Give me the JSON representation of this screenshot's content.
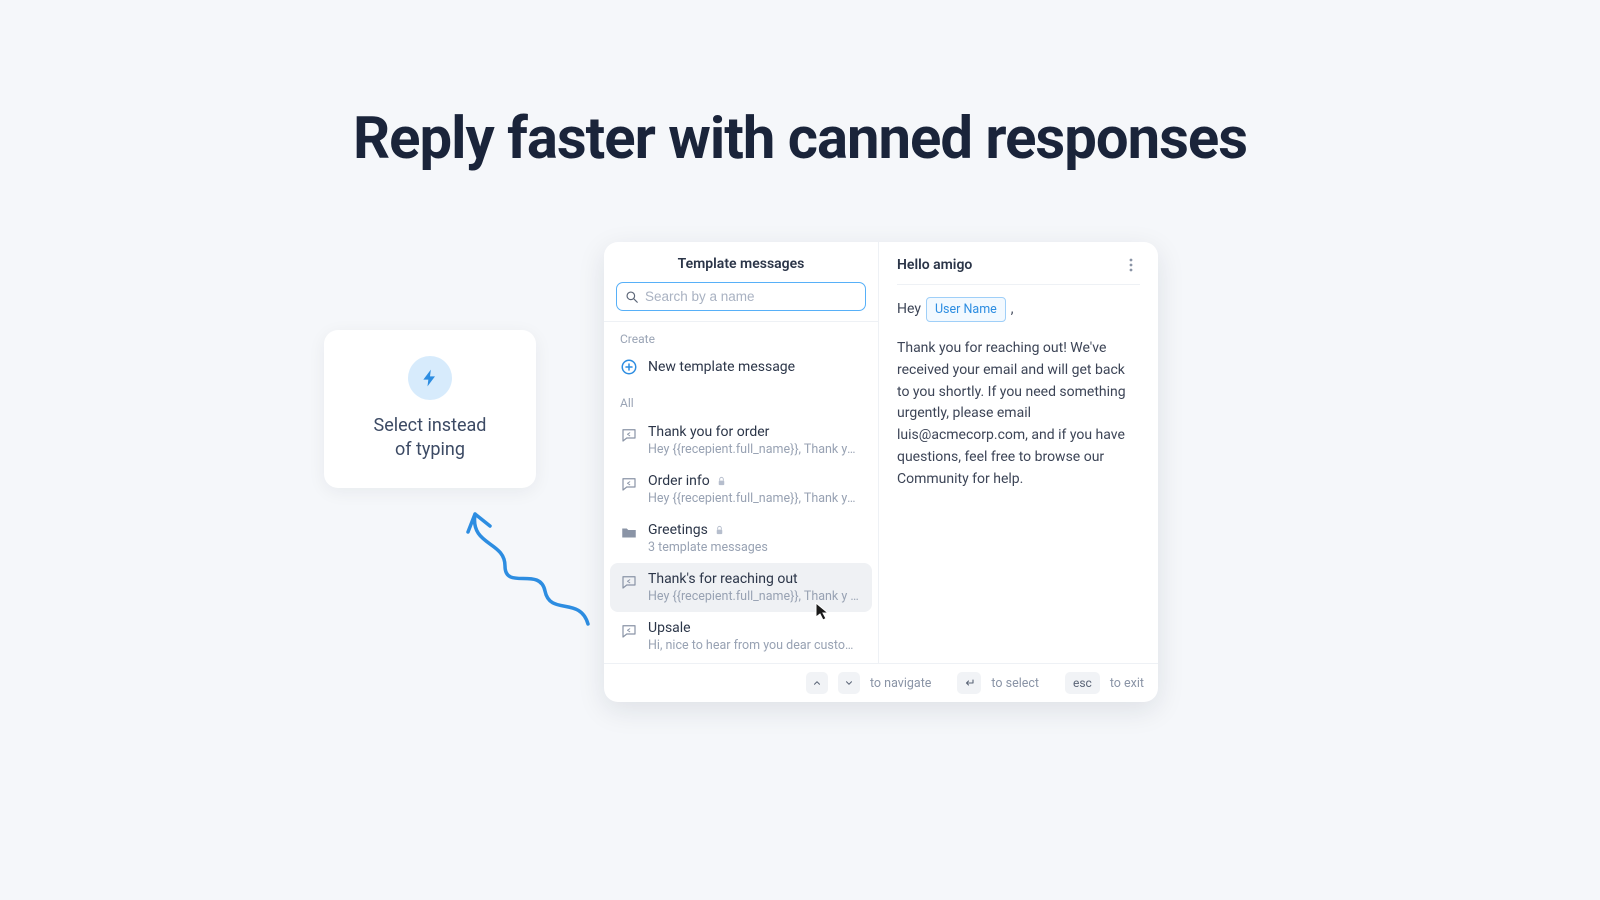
{
  "hero_title": "Reply faster with canned responses",
  "callout": {
    "line1": "Select instead",
    "line2": "of typing"
  },
  "modal": {
    "left_title": "Template messages",
    "search_placeholder": "Search by a name",
    "section_create": "Create",
    "new_template_label": "New template message",
    "section_all": "All",
    "items": [
      {
        "title": "Thank you for order",
        "subtitle": "Hey {{recepient.full_name}}, Thank you for yo...",
        "type": "msg",
        "locked": false
      },
      {
        "title": "Order info",
        "subtitle": "Hey {{recepient.full_name}}, Thank you for yo...",
        "type": "msg",
        "locked": true
      },
      {
        "title": "Greetings",
        "subtitle": "3 template messages",
        "type": "folder",
        "locked": true
      },
      {
        "title": "Thank's for reaching out",
        "subtitle": "Hey {{recepient.full_name}}, Thank y    for yo...",
        "type": "msg",
        "locked": false
      },
      {
        "title": "Upsale",
        "subtitle": "Hi, nice to hear from you dear customer, how...",
        "type": "msg",
        "locked": false
      }
    ],
    "preview": {
      "title": "Hello amigo",
      "greeting_prefix": "Hey",
      "chip": "User Name",
      "greeting_suffix": ",",
      "body": "Thank you for reaching out! We've received your email and will get back to you shortly. If you need something urgently, please email luis@acmecorp.com, and if you have questions, feel free to browse our Community for help."
    },
    "footer": {
      "navigate": "to navigate",
      "select": "to select",
      "esc_key": "esc",
      "exit": "to exit"
    }
  }
}
